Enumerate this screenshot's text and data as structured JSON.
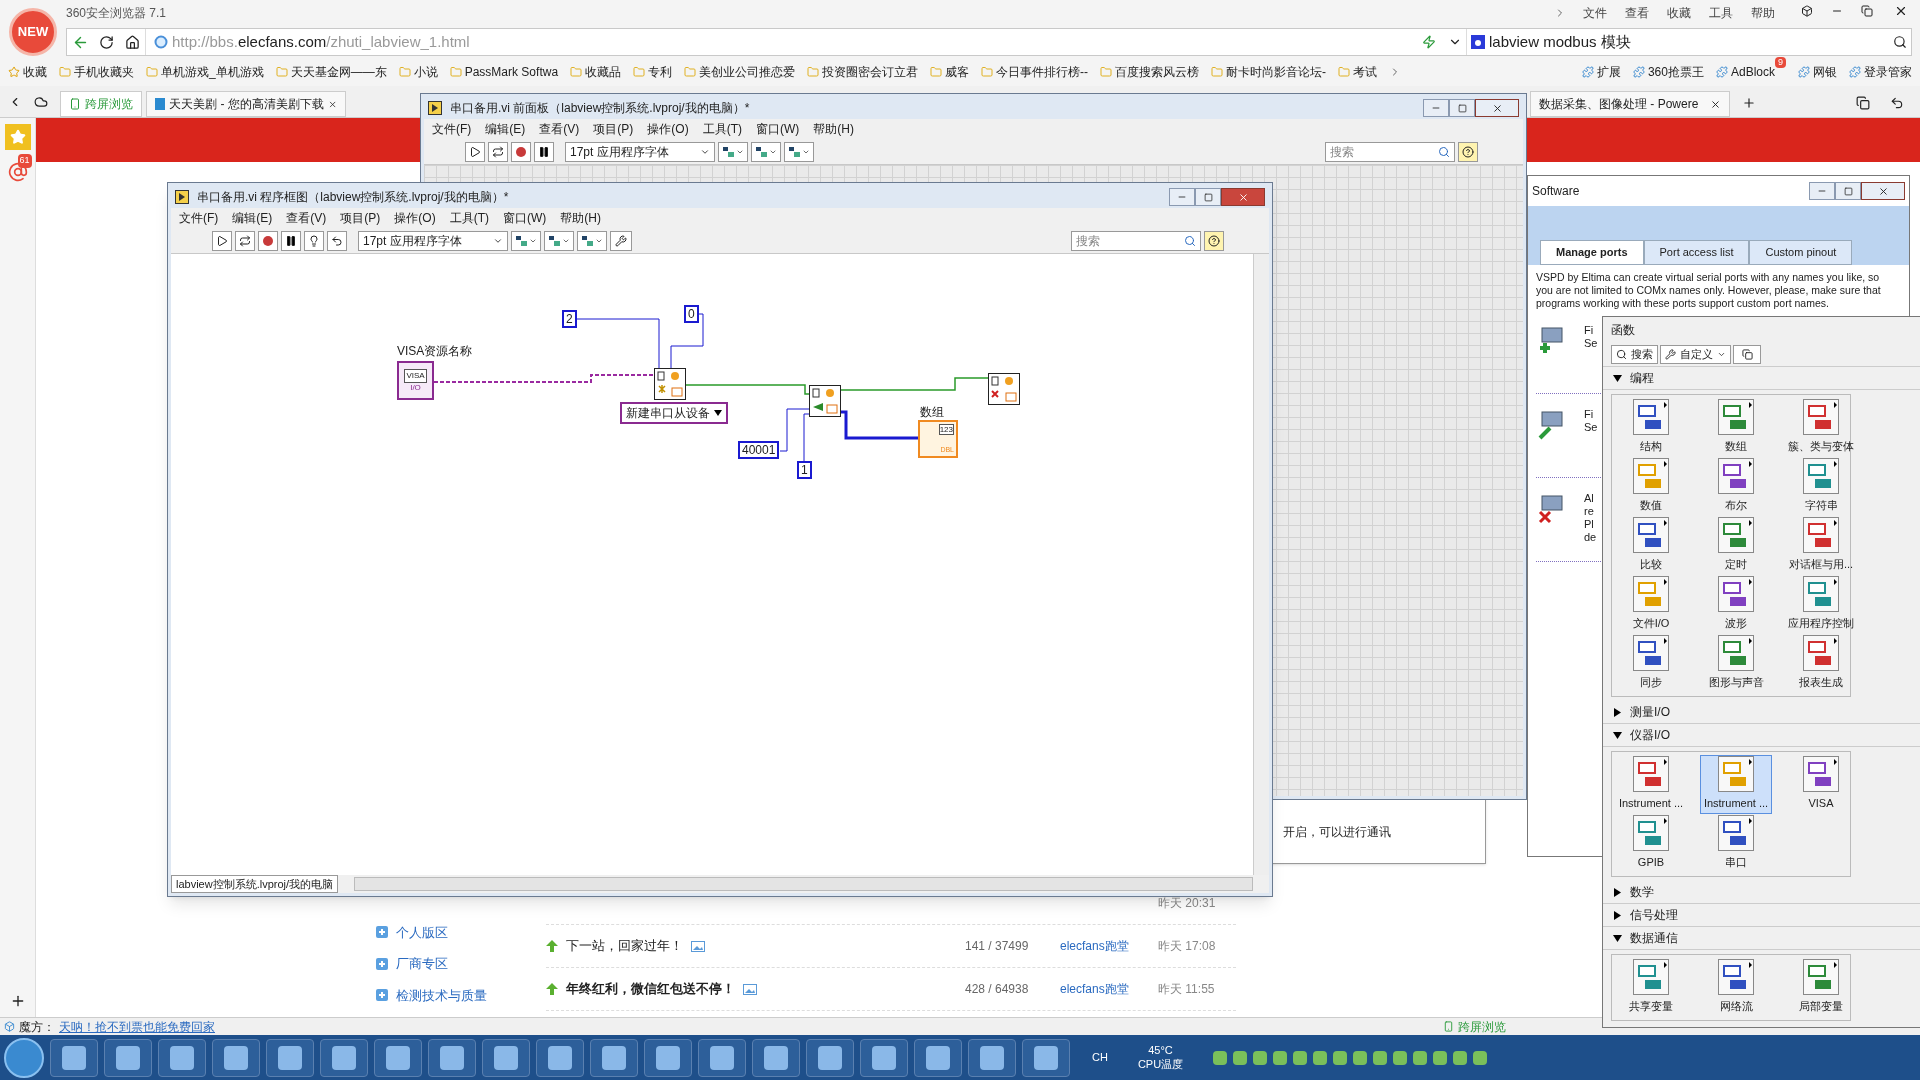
{
  "browser": {
    "title": "360安全浏览器 7.1",
    "logo_text": "NEW",
    "menu": [
      "文件",
      "查看",
      "收藏",
      "工具",
      "帮助"
    ],
    "url_prefix": "http://bbs.",
    "url_domain": "elecfans.com",
    "url_path": "/zhuti_labview_1.html",
    "search_value": "labview modbus 模块",
    "bookmarks": [
      "收藏",
      "手机收藏夹",
      "单机游戏_单机游戏",
      "天天基金网——东",
      "小说",
      "PassMark Softwa",
      "收藏品",
      "专利",
      "美创业公司推恋爱",
      "投资圈密会订立君",
      "威客",
      "今日事件排行榜--",
      "百度搜索风云榜",
      "耐卡时尚影音论坛-",
      "考试"
    ],
    "extensions": [
      {
        "label": "扩展"
      },
      {
        "label": "360抢票王"
      },
      {
        "label": "AdBlock",
        "badge": "9"
      },
      {
        "label": "网银"
      },
      {
        "label": "登录管家"
      }
    ],
    "cross_screen": "跨屏浏览",
    "tabs": [
      {
        "label": "天天美剧 - 您的高清美剧下载"
      },
      {
        "label": "数据采集、图像处理 - Powere"
      }
    ],
    "side_badge": "61"
  },
  "forum": {
    "sidebar": [
      "个人版区",
      "厂商专区",
      "检测技术与质量"
    ],
    "covered_row_time": "昨天 20:31",
    "rows": [
      {
        "title": "下一站，回家过年！",
        "bold": false,
        "stats": "141 / 37499",
        "author": "elecfans跑堂",
        "time": "昨天 17:08"
      },
      {
        "title": "年终红利，微信红包送不停！",
        "bold": true,
        "stats": "428 / 64938",
        "author": "elecfans跑堂",
        "time": "昨天 11:55"
      }
    ]
  },
  "status_bar": {
    "label": "魔方：",
    "link": "天呐！抢不到票也能免费回家",
    "cross_screen": "跨屏浏览"
  },
  "back_window": {
    "text": "开启，可以进行通讯"
  },
  "front_panel": {
    "title": "串口备用.vi 前面板（labview控制系统.lvproj/我的电脑）*",
    "menu": [
      "文件(F)",
      "编辑(E)",
      "查看(V)",
      "项目(P)",
      "操作(O)",
      "工具(T)",
      "窗口(W)",
      "帮助(H)"
    ],
    "font": "17pt 应用程序字体",
    "search_placeholder": "搜索"
  },
  "block_diagram": {
    "title": "串口备用.vi 程序框图（labview控制系统.lvproj/我的电脑）*",
    "menu": [
      "文件(F)",
      "编辑(E)",
      "查看(V)",
      "项目(P)",
      "操作(O)",
      "工具(T)",
      "窗口(W)",
      "帮助(H)"
    ],
    "font": "17pt 应用程序字体",
    "search_placeholder": "搜索",
    "path": "labview控制系统.lvproj/我的电脑",
    "visa": {
      "label": "VISA资源名称",
      "text": "VISA",
      "footer": "I/O"
    },
    "constants": [
      "2",
      "0",
      "40001",
      "1"
    ],
    "enum": "新建串口从设备",
    "array": {
      "label": "数组",
      "header": "123",
      "footer": "DBL"
    }
  },
  "vspd": {
    "title": "Software",
    "tabs": [
      {
        "label": "Manage ports",
        "selected": true
      },
      {
        "label": "Port access list",
        "selected": false
      },
      {
        "label": "Custom pinout",
        "selected": false
      }
    ],
    "description": "VSPD by Eltima can create virtual serial ports with any names you like, so you are not limited to COMx names only. However, please, make sure that programs working with these ports support custom port names.",
    "actions": [
      {
        "kind": "add",
        "lines": [
          "Fi",
          "Se"
        ]
      },
      {
        "kind": "edit",
        "lines": [
          "Fi",
          "Se"
        ]
      },
      {
        "kind": "remove",
        "lines": [
          "Al",
          "re",
          "Pl",
          "de"
        ]
      }
    ]
  },
  "functions": {
    "title": "函数",
    "search": "搜索",
    "customize": "自定义",
    "sections": [
      {
        "label": "编程",
        "expanded": true,
        "items": [
          {
            "label": "结构",
            "selected": false
          },
          {
            "label": "数组",
            "selected": false
          },
          {
            "label": "簇、类与变体",
            "selected": false
          },
          {
            "label": "数值",
            "selected": false
          },
          {
            "label": "布尔",
            "selected": false
          },
          {
            "label": "字符串",
            "selected": false
          },
          {
            "label": "比较",
            "selected": false
          },
          {
            "label": "定时",
            "selected": false
          },
          {
            "label": "对话框与用...",
            "selected": false
          },
          {
            "label": "文件I/O",
            "selected": false
          },
          {
            "label": "波形",
            "selected": false
          },
          {
            "label": "应用程序控制",
            "selected": false
          },
          {
            "label": "同步",
            "selected": false
          },
          {
            "label": "图形与声音",
            "selected": false
          },
          {
            "label": "报表生成",
            "selected": false
          }
        ]
      },
      {
        "label": "测量I/O",
        "expanded": false
      },
      {
        "label": "仪器I/O",
        "expanded": true,
        "items": [
          {
            "label": "Instrument ...",
            "selected": false
          },
          {
            "label": "Instrument ...",
            "selected": true
          },
          {
            "label": "VISA",
            "selected": false
          },
          {
            "label": "GPIB",
            "selected": false
          },
          {
            "label": "串口",
            "selected": false
          }
        ]
      },
      {
        "label": "数学",
        "expanded": false
      },
      {
        "label": "信号处理",
        "expanded": false
      },
      {
        "label": "数据通信",
        "expanded": true,
        "items": [
          {
            "label": "共享变量",
            "selected": false
          },
          {
            "label": "网络流",
            "selected": false
          },
          {
            "label": "局部变量",
            "selected": false
          }
        ]
      }
    ]
  },
  "taskbar": {
    "lang": "CH",
    "temp": "45°C",
    "temp_label": "CPU温度"
  }
}
